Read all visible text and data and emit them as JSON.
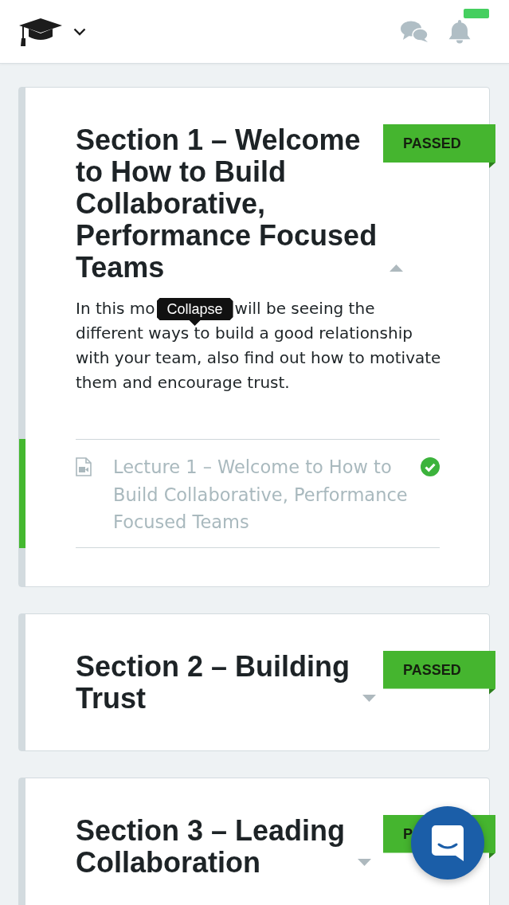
{
  "header": {
    "has_unread_notifications": true
  },
  "sections": [
    {
      "title": "Section 1 – Welcome to How to Build Collaborative, Performance Focused Teams",
      "badge": {
        "label": "PASSED",
        "kind": "passed"
      },
      "expanded": true,
      "tooltip": "Collapse",
      "description_parts": [
        "In this mo",
        "will be seeing the",
        "different ways to build a good relationship with your team, also find out how to motivate them and encourage trust."
      ],
      "lectures": [
        {
          "kind": "video",
          "title": "Lecture 1 – Welcome to How to Build Collaborative, Performance Focused Teams",
          "completed": true,
          "active": true
        }
      ]
    },
    {
      "title": "Section 2 – Building Trust",
      "badge": {
        "label": "PASSED",
        "kind": "passed"
      },
      "expanded": false
    },
    {
      "title": "Section 3 – Leading Collaboration",
      "badge": {
        "label": "P",
        "kind": "passed"
      },
      "expanded": false
    }
  ]
}
